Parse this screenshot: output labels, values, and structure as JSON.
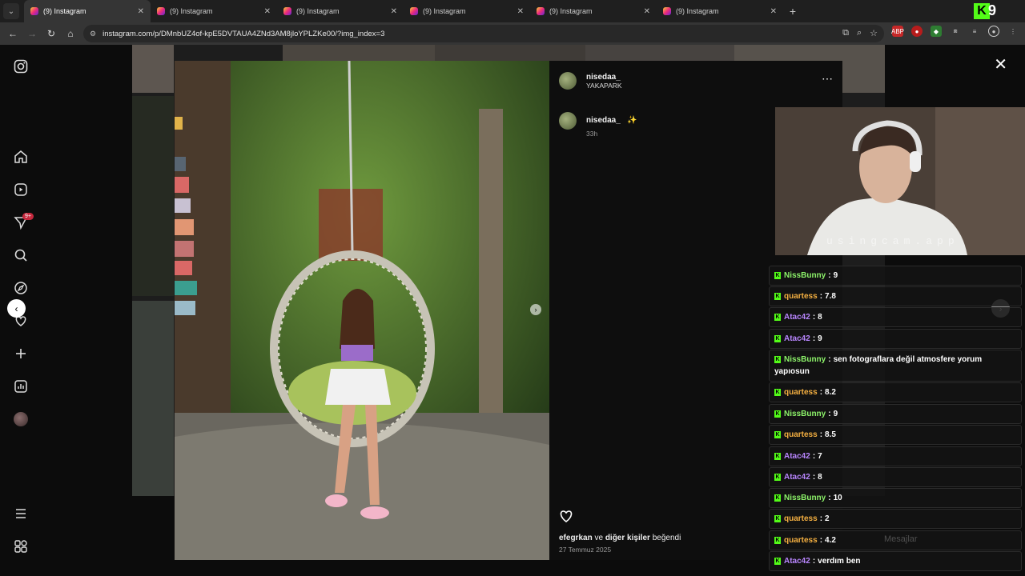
{
  "browser": {
    "tabs": [
      {
        "title": "(9) Instagram",
        "active": true
      },
      {
        "title": "(9) Instagram",
        "active": false
      },
      {
        "title": "(9) Instagram",
        "active": false
      },
      {
        "title": "(9) Instagram",
        "active": false
      },
      {
        "title": "(9) Instagram",
        "active": false
      },
      {
        "title": "(9) Instagram",
        "active": false
      }
    ],
    "url": "instagram.com/p/DMnbUZ4of-kpE5DVTAUA4ZNd3AM8jloYPLZKe00/?img_index=3",
    "ext_badge_number": "9"
  },
  "post": {
    "username": "nisedaa_",
    "location": "YAKAPARK",
    "caption_user": "nisedaa_",
    "caption_emoji": "✨",
    "caption_time": "33h",
    "likes_user": "efegrkan",
    "likes_connector": "ve",
    "likes_others": "diğer kişiler",
    "likes_suffix": "beğendi",
    "date": "27 Temmuz 2025"
  },
  "sidebar": {
    "notification_badge": "9+"
  },
  "cam": {
    "watermark": "usingcam.app"
  },
  "chat": {
    "messages": [
      {
        "user": "NissBunny",
        "text": "9",
        "color": "#8df36a"
      },
      {
        "user": "quartess",
        "text": "7.8",
        "color": "#f5b041"
      },
      {
        "user": "Atac42",
        "text": "8",
        "color": "#b986ff"
      },
      {
        "user": "Atac42",
        "text": "9",
        "color": "#b986ff"
      },
      {
        "user": "NissBunny",
        "text": "sen fotograflara değil atmosfere yorum yapıosun",
        "color": "#8df36a"
      },
      {
        "user": "quartess",
        "text": "8.2",
        "color": "#f5b041"
      },
      {
        "user": "NissBunny",
        "text": "9",
        "color": "#8df36a"
      },
      {
        "user": "quartess",
        "text": "8.5",
        "color": "#f5b041"
      },
      {
        "user": "Atac42",
        "text": "7",
        "color": "#b986ff"
      },
      {
        "user": "Atac42",
        "text": "8",
        "color": "#b986ff"
      },
      {
        "user": "NissBunny",
        "text": "10",
        "color": "#8df36a"
      },
      {
        "user": "quartess",
        "text": "2",
        "color": "#f5b041"
      },
      {
        "user": "quartess",
        "text": "4.2",
        "color": "#f5b041"
      },
      {
        "user": "Atac42",
        "text": "verdım ben",
        "color": "#b986ff"
      }
    ],
    "separator": ":"
  },
  "dm_bar": {
    "label": "Mesajlar"
  }
}
